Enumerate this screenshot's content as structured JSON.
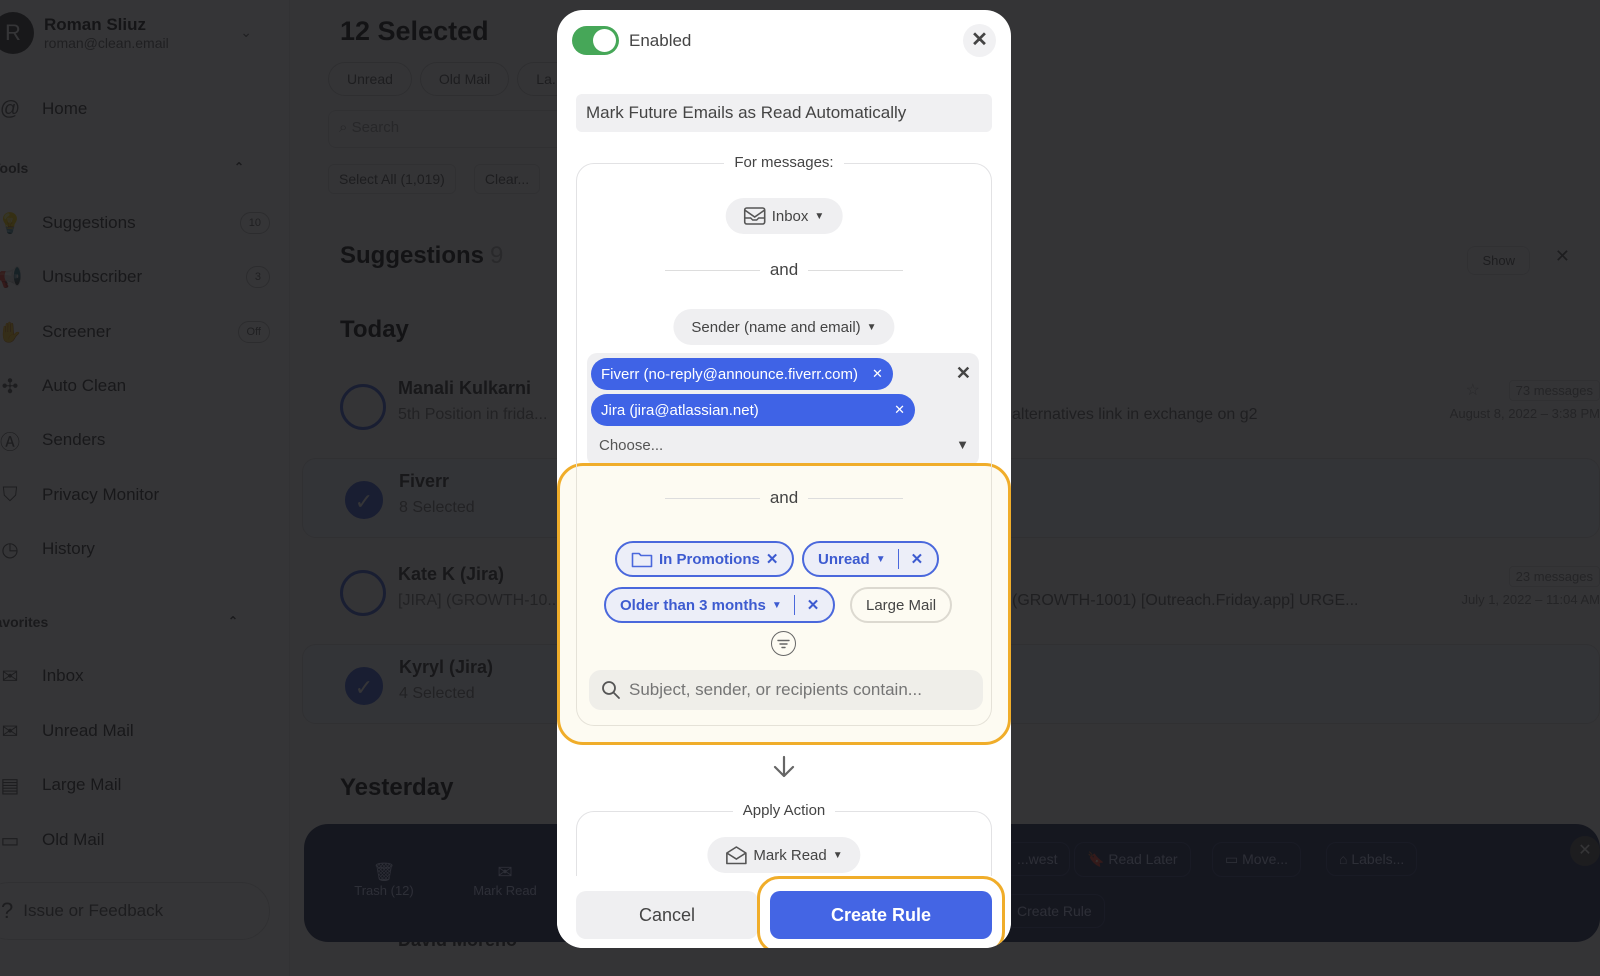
{
  "background": {
    "account": {
      "initial": "R",
      "name": "Roman Sliuz",
      "email": "roman@clean.email"
    },
    "nav": {
      "home": "Home",
      "tools_title": "Tools",
      "tools": [
        {
          "label": "Suggestions",
          "badge": "10",
          "icon": "lightbulb-icon"
        },
        {
          "label": "Unsubscriber",
          "badge": "3",
          "icon": "megaphone-off-icon"
        },
        {
          "label": "Screener",
          "badge": "Off",
          "icon": "hand-icon"
        },
        {
          "label": "Auto Clean",
          "badge": "",
          "icon": "auto-clean-icon"
        },
        {
          "label": "Senders",
          "badge": "",
          "icon": "senders-icon"
        },
        {
          "label": "Privacy Monitor",
          "badge": "",
          "icon": "shield-check-icon"
        },
        {
          "label": "History",
          "badge": "",
          "icon": "clock-icon"
        }
      ],
      "favorites_title": "Favorites",
      "favorites": [
        {
          "label": "Inbox",
          "icon": "inbox-icon"
        },
        {
          "label": "Unread Mail",
          "icon": "unread-mail-icon"
        },
        {
          "label": "Large Mail",
          "icon": "large-mail-icon"
        },
        {
          "label": "Old Mail",
          "icon": "old-mail-icon"
        }
      ],
      "feedback": "Issue or Feedback"
    },
    "main": {
      "title": "12 Selected",
      "chips": [
        "Unread",
        "Old Mail",
        "La..."
      ],
      "search_placeholder": "Search",
      "select_all": "Select All (1,019)",
      "clear": "Clear...",
      "suggestions_title": "Suggestions",
      "suggestions_count": "9",
      "show": "Show",
      "today": "Today",
      "yesterday": "Yesterday",
      "rows": [
        {
          "name": "Manali Kulkarni",
          "sub": "5th Position in frida...",
          "snippet": "alternatives link in exchange on g2",
          "messages": "73 messages",
          "date": "August 8, 2022 – 3:38 PM",
          "selected": false
        },
        {
          "name": "Fiverr",
          "sub": "8 Selected",
          "snippet": "",
          "messages": "",
          "date": "",
          "selected": true
        },
        {
          "name": "Kate K (Jira)",
          "sub": "[JIRA] (GROWTH-10...",
          "snippet": "(GROWTH-1001) [Outreach.Friday.app] URGE...",
          "messages": "23 messages",
          "date": "July 1, 2022 – 11:04 AM",
          "selected": false
        },
        {
          "name": "Kyryl (Jira)",
          "sub": "4 Selected",
          "snippet": "",
          "messages": "",
          "date": "",
          "selected": true
        }
      ],
      "last_row_name": "David Moreno"
    },
    "action_bar": {
      "trash": "Trash (12)",
      "mark_read": "Mark Read",
      "newest": "...west",
      "read_later": "Read Later",
      "move": "Move...",
      "labels": "Labels...",
      "create_rule": "Create Rule"
    }
  },
  "modal": {
    "enabled_label": "Enabled",
    "enabled": true,
    "rule_name": "Mark Future Emails as Read Automatically",
    "for_messages_legend": "For messages:",
    "folder": "Inbox",
    "and_label": "and",
    "sender_field": "Sender (name and email)",
    "senders": [
      "Fiverr (no-reply@announce.fiverr.com)",
      "Jira (jira@atlassian.net)"
    ],
    "sender_placeholder": "Choose...",
    "conditions": {
      "promotions": "In Promotions",
      "unread": "Unread",
      "older": "Older than 3 months",
      "large_mail": "Large Mail"
    },
    "search_placeholder": "Subject, sender, or recipients contain...",
    "apply_action_legend": "Apply Action",
    "action": "Mark Read",
    "cancel": "Cancel",
    "create": "Create Rule",
    "highlight_color": "#f0ad2a",
    "accent_color": "#4465e4"
  }
}
